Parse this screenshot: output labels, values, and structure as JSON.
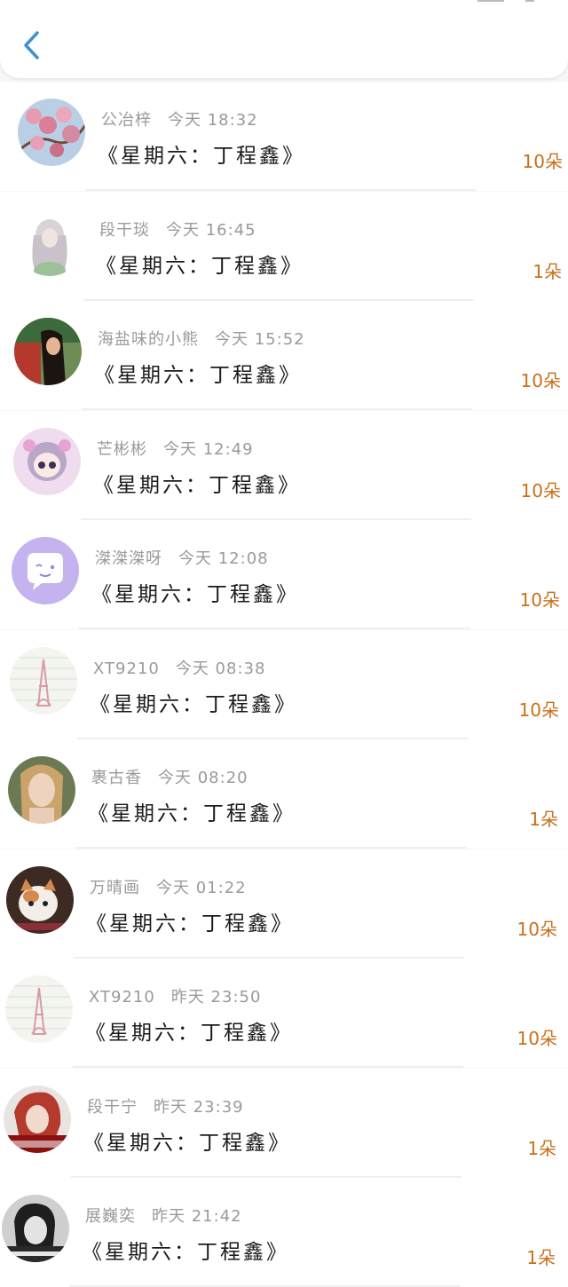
{
  "header": {
    "back_label": ""
  },
  "colors": {
    "count": "#c8701a",
    "name": "#9a9a9a",
    "title": "#1a1a1a"
  },
  "items": [
    {
      "name": "公冶梓",
      "time": "今天 18:32",
      "title": "《星期六：丁程鑫》",
      "count": "10朵",
      "avatar": "cherry-blossom-avatar"
    },
    {
      "name": "段干琰",
      "time": "今天 16:45",
      "title": "《星期六：丁程鑫》",
      "count": "1朵",
      "avatar": "girl-sketch-avatar"
    },
    {
      "name": "海盐味的小熊",
      "time": "今天 15:52",
      "title": "《星期六：丁程鑫》",
      "count": "10朵",
      "avatar": "girl-long-hair-avatar"
    },
    {
      "name": "芒彬彬",
      "time": "今天 12:49",
      "title": "《星期六：丁程鑫》",
      "count": "10朵",
      "avatar": "anime-girl-avatar"
    },
    {
      "name": "滐滐滐呀",
      "time": "今天 12:08",
      "title": "《星期六：丁程鑫》",
      "count": "10朵",
      "avatar": "chat-bubble-avatar"
    },
    {
      "name": "XT9210",
      "time": "今天 08:38",
      "title": "《星期六：丁程鑫》",
      "count": "10朵",
      "avatar": "eiffel-tower-avatar"
    },
    {
      "name": "裹古香",
      "time": "今天 08:20",
      "title": "《星期六：丁程鑫》",
      "count": "1朵",
      "avatar": "woman-portrait-avatar"
    },
    {
      "name": "万晴画",
      "time": "今天 01:22",
      "title": "《星期六：丁程鑫》",
      "count": "10朵",
      "avatar": "cat-avatar"
    },
    {
      "name": "XT9210",
      "time": "昨天 23:50",
      "title": "《星期六：丁程鑫》",
      "count": "10朵",
      "avatar": "eiffel-tower-avatar"
    },
    {
      "name": "段干宁",
      "time": "昨天 23:39",
      "title": "《星期六：丁程鑫》",
      "count": "1朵",
      "avatar": "red-hair-woman-avatar"
    },
    {
      "name": "展巍奕",
      "time": "昨天 21:42",
      "title": "《星期六：丁程鑫》",
      "count": "1朵",
      "avatar": "boy-bw-avatar"
    }
  ]
}
